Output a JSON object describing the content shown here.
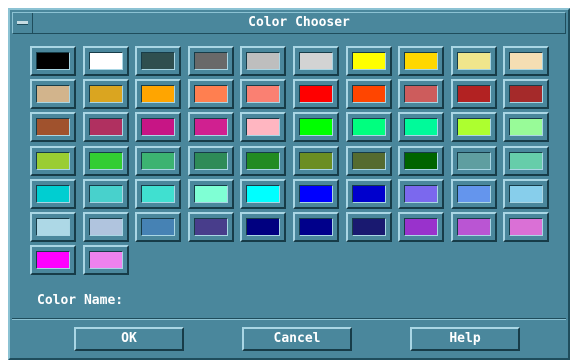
{
  "window": {
    "title": "Color Chooser"
  },
  "colors": [
    "#000000",
    "#ffffff",
    "#2f4f4f",
    "#696969",
    "#bebebe",
    "#d3d3d3",
    "#ffff00",
    "#ffd700",
    "#f0e68c",
    "#f5deb3",
    "#d2b48c",
    "#daa520",
    "#ffa500",
    "#ff7f50",
    "#fa8072",
    "#ff0000",
    "#ff4500",
    "#cd5c5c",
    "#b22222",
    "#a52a2a",
    "#a0522d",
    "#b03060",
    "#c71585",
    "#d02090",
    "#ffb6c1",
    "#00ff00",
    "#00ff7f",
    "#00fa9a",
    "#adff2f",
    "#98fb98",
    "#9acd32",
    "#32cd32",
    "#3cb371",
    "#2e8b57",
    "#228b22",
    "#6b8e23",
    "#556b2f",
    "#006400",
    "#5f9ea0",
    "#66cdaa",
    "#00ced1",
    "#48d1cc",
    "#40e0d0",
    "#7fffd4",
    "#00ffff",
    "#0000ff",
    "#0000cd",
    "#7b68ee",
    "#6495ed",
    "#87ceeb",
    "#add8e6",
    "#b0c4de",
    "#4682b4",
    "#483d8b",
    "#000080",
    "#00008b",
    "#191970",
    "#9932cc",
    "#ba55d3",
    "#da70d6",
    "#ff00ff",
    "#ee82ee"
  ],
  "color_name_label": "Color Name:",
  "buttons": {
    "ok": "OK",
    "cancel": "Cancel",
    "help": "Help"
  }
}
